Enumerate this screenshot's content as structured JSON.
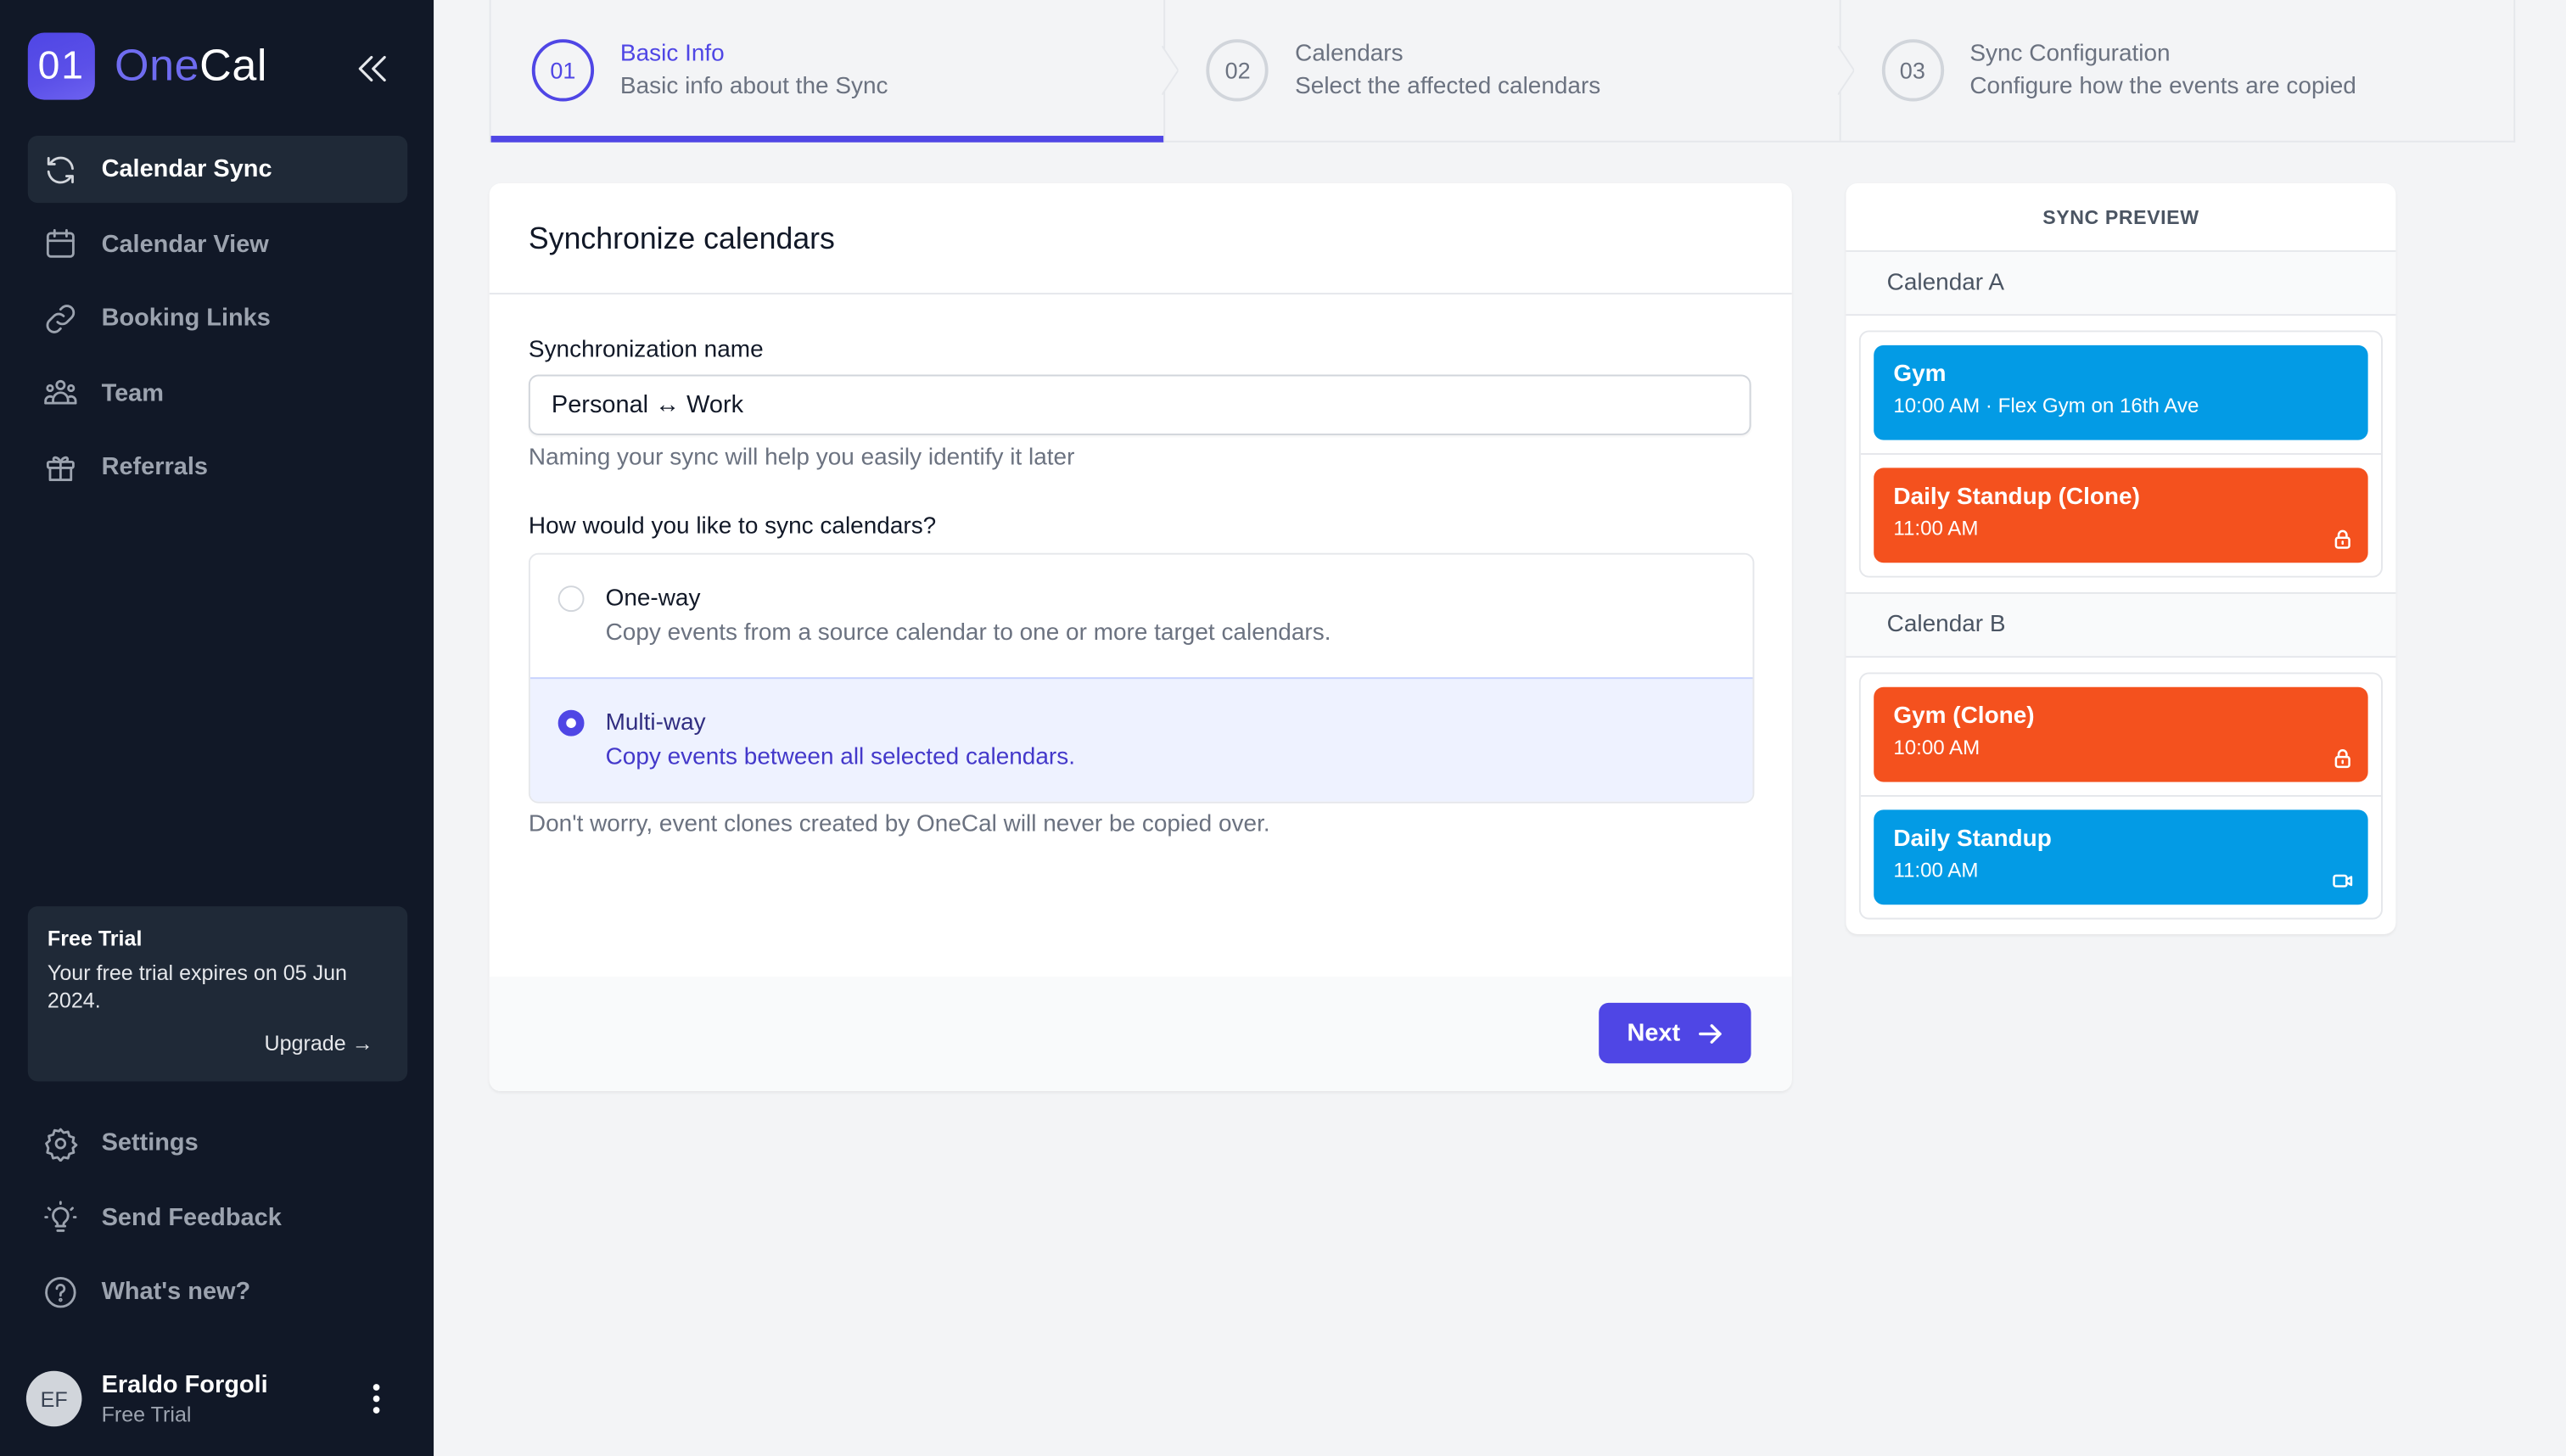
{
  "app": {
    "logo_badge": "01",
    "logo_part1": "One",
    "logo_part2": "Cal",
    "brand_color": "#4f46e5"
  },
  "sidebar": {
    "collapse_icon": "chevrons-left-icon",
    "items": [
      {
        "label": "Calendar Sync",
        "icon": "refresh-icon",
        "active": true
      },
      {
        "label": "Calendar View",
        "icon": "calendar-icon",
        "active": false
      },
      {
        "label": "Booking Links",
        "icon": "link-icon",
        "active": false
      },
      {
        "label": "Team",
        "icon": "team-icon",
        "active": false
      },
      {
        "label": "Referrals",
        "icon": "gift-icon",
        "active": false
      }
    ],
    "trial": {
      "title": "Free Trial",
      "text": "Your free trial expires on 05 Jun 2024.",
      "upgrade_label": "Upgrade →"
    },
    "bottom_items": [
      {
        "label": "Settings",
        "icon": "gear-icon"
      },
      {
        "label": "Send Feedback",
        "icon": "lightbulb-icon"
      },
      {
        "label": "What's new?",
        "icon": "question-circle-icon"
      }
    ],
    "user": {
      "initials": "EF",
      "name": "Eraldo Forgoli",
      "plan": "Free Trial"
    }
  },
  "stepper": {
    "steps": [
      {
        "number": "01",
        "title": "Basic Info",
        "subtitle": "Basic info about the Sync",
        "active": true
      },
      {
        "number": "02",
        "title": "Calendars",
        "subtitle": "Select the affected calendars",
        "active": false
      },
      {
        "number": "03",
        "title": "Sync Configuration",
        "subtitle": "Configure how the events are copied",
        "active": false
      }
    ]
  },
  "form": {
    "title": "Synchronize calendars",
    "name_label": "Synchronization name",
    "name_value": "Personal ↔ Work",
    "name_helper": "Naming your sync will help you easily identify it later",
    "mode_label": "How would you like to sync calendars?",
    "options": [
      {
        "title": "One-way",
        "description": "Copy events from a source calendar to one or more target calendars.",
        "selected": false
      },
      {
        "title": "Multi-way",
        "description": "Copy events between all selected calendars.",
        "selected": true
      }
    ],
    "note": "Don't worry, event clones created by OneCal will never be copied over.",
    "next_label": "Next"
  },
  "preview": {
    "title": "SYNC PREVIEW",
    "calendars": [
      {
        "name": "Calendar A",
        "events": [
          {
            "title": "Gym",
            "subtitle": "10:00 AM · Flex Gym on 16th Ave",
            "color": "#039be5",
            "icon": null
          },
          {
            "title": "Daily Standup (Clone)",
            "subtitle": "11:00 AM",
            "color": "#f4511e",
            "icon": "lock-icon"
          }
        ]
      },
      {
        "name": "Calendar B",
        "events": [
          {
            "title": "Gym (Clone)",
            "subtitle": "10:00 AM",
            "color": "#f4511e",
            "icon": "lock-icon"
          },
          {
            "title": "Daily Standup",
            "subtitle": "11:00 AM",
            "color": "#039be5",
            "icon": "video-icon"
          }
        ]
      }
    ]
  }
}
